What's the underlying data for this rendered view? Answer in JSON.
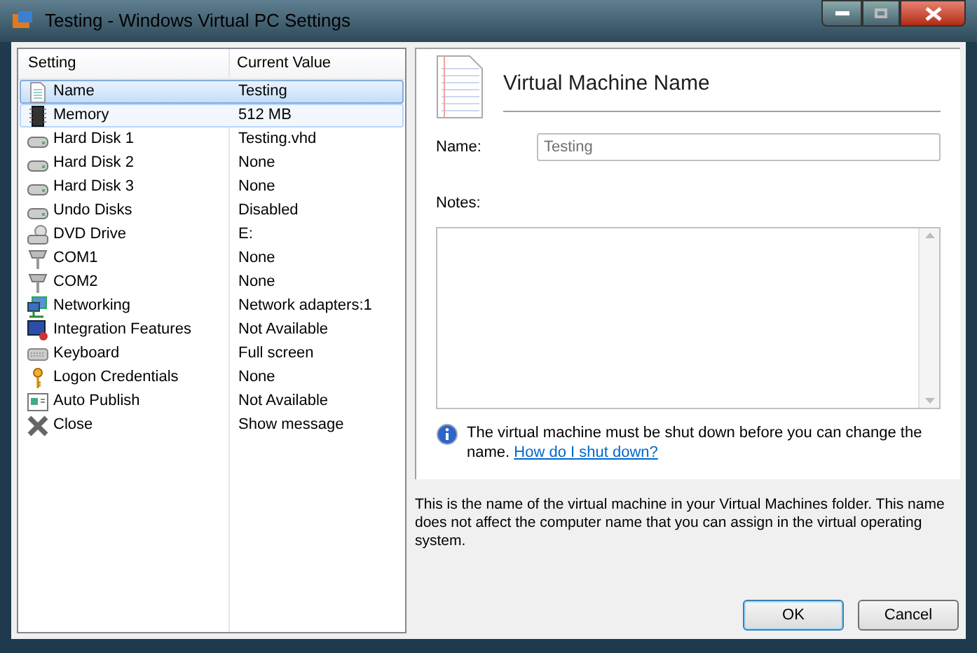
{
  "window": {
    "title": "Testing - Windows Virtual PC Settings"
  },
  "settings_list": {
    "columns": [
      "Setting",
      "Current Value"
    ],
    "rows": [
      {
        "setting": "Name",
        "value": "Testing",
        "selected": true,
        "hovered": false
      },
      {
        "setting": "Memory",
        "value": "512 MB",
        "selected": false,
        "hovered": true
      },
      {
        "setting": "Hard Disk 1",
        "value": "Testing.vhd",
        "selected": false,
        "hovered": false
      },
      {
        "setting": "Hard Disk 2",
        "value": "None",
        "selected": false,
        "hovered": false
      },
      {
        "setting": "Hard Disk 3",
        "value": "None",
        "selected": false,
        "hovered": false
      },
      {
        "setting": "Undo Disks",
        "value": "Disabled",
        "selected": false,
        "hovered": false
      },
      {
        "setting": "DVD Drive",
        "value": "E:",
        "selected": false,
        "hovered": false
      },
      {
        "setting": "COM1",
        "value": "None",
        "selected": false,
        "hovered": false
      },
      {
        "setting": "COM2",
        "value": "None",
        "selected": false,
        "hovered": false
      },
      {
        "setting": "Networking",
        "value": "Network adapters:1",
        "selected": false,
        "hovered": false
      },
      {
        "setting": "Integration Features",
        "value": "Not Available",
        "selected": false,
        "hovered": false
      },
      {
        "setting": "Keyboard",
        "value": "Full screen",
        "selected": false,
        "hovered": false
      },
      {
        "setting": "Logon Credentials",
        "value": "None",
        "selected": false,
        "hovered": false
      },
      {
        "setting": "Auto Publish",
        "value": "Not Available",
        "selected": false,
        "hovered": false
      },
      {
        "setting": "Close",
        "value": "Show message",
        "selected": false,
        "hovered": false
      }
    ]
  },
  "detail": {
    "heading": "Virtual Machine Name",
    "name_label": "Name:",
    "name_value": "Testing",
    "name_disabled": true,
    "notes_label": "Notes:",
    "info": "The virtual machine must be shut down before you can change the name.",
    "info_link": "How do I shut down?"
  },
  "description": "This is the name of the virtual machine in your Virtual Machines folder. This name does not affect the computer name that you can assign in the virtual operating system.",
  "buttons": [
    {
      "label": "OK",
      "default": true
    },
    {
      "label": "Cancel",
      "default": false
    }
  ]
}
